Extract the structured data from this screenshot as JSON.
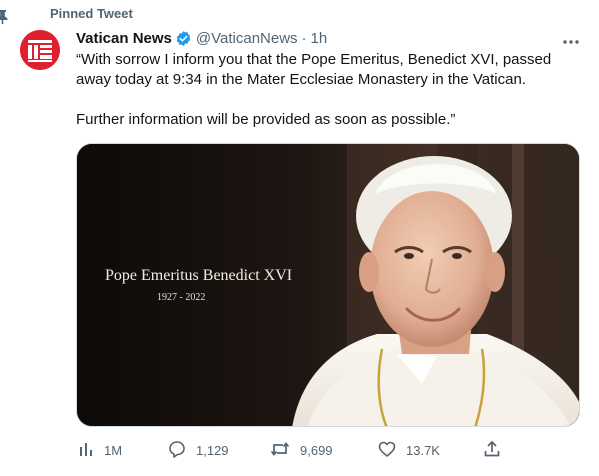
{
  "pinned": {
    "label": "Pinned Tweet",
    "icon": "pin-icon"
  },
  "author": {
    "name": "Vatican News",
    "handle": "@VaticanNews",
    "separator": "·",
    "time": "1h",
    "avatar_color": "#e0202e",
    "verified_color": "#1d9bf0"
  },
  "tweet": {
    "line1": "“With sorrow I inform you that the Pope Emeritus, Benedict XVI, passed away today at 9:34 in the Mater Ecclesiae Monastery in the Vatican.",
    "line2": "Further information will be provided as soon as possible.”"
  },
  "media": {
    "title": "Pope Emeritus Benedict XVI",
    "years": "1927 - 2022"
  },
  "actions": {
    "views": "1M",
    "replies": "1,129",
    "retweets": "9,699",
    "likes": "13.7K"
  },
  "colors": {
    "secondary_text": "#536471",
    "primary_text": "#0f1419"
  }
}
